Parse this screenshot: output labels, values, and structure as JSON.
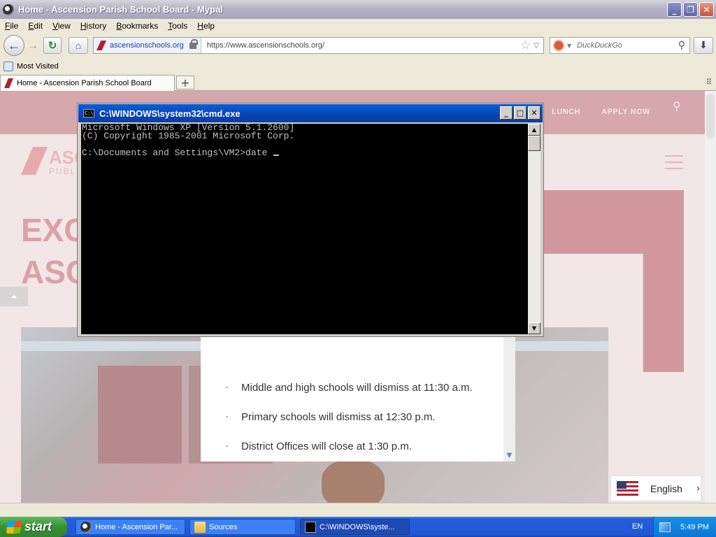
{
  "browser": {
    "title": "Home - Ascension Parish School Board - Mypal",
    "menu": [
      "File",
      "Edit",
      "View",
      "History",
      "Bookmarks",
      "Tools",
      "Help"
    ],
    "site_domain": "ascensionschools.org",
    "url": "https://www.ascensionschools.org/",
    "search_placeholder": "DuckDuckGo",
    "bookmark": "Most Visited",
    "tab_title": "Home - Ascension Parish School Board",
    "icons": {
      "back": "arrow-left-icon",
      "forward": "arrow-right-icon",
      "reload": "reload-icon",
      "home": "home-icon",
      "bookmark_star": "star-icon",
      "download": "download-arrow-icon"
    }
  },
  "page": {
    "nav": [
      "LUNCH",
      "APPLY NOW"
    ],
    "logo_text": "ASC",
    "logo_sub": "PUBLI",
    "hero": [
      "EXC",
      "ASC"
    ],
    "notices": [
      "Middle and high schools will dismiss at 11:30 a.m.",
      "Primary schools will dismiss at 12:30 p.m.",
      "District Offices will close at 1:30 p.m."
    ],
    "language": "English",
    "colors": {
      "brand_red": "#b3202c",
      "overlay": "#f2e6e7"
    }
  },
  "cmd": {
    "title": "C:\\WINDOWS\\system32\\cmd.exe",
    "lines": [
      "Microsoft Windows XP [Version 5.1.2600]",
      "(C) Copyright 1985-2001 Microsoft Corp.",
      "",
      "C:\\Documents and Settings\\VM2>date "
    ]
  },
  "taskbar": {
    "start": "start",
    "tasks": [
      "Home - Ascension Par...",
      "Sources",
      "C:\\WINDOWS\\syste..."
    ],
    "language": "EN",
    "clock": "5:49 PM"
  }
}
